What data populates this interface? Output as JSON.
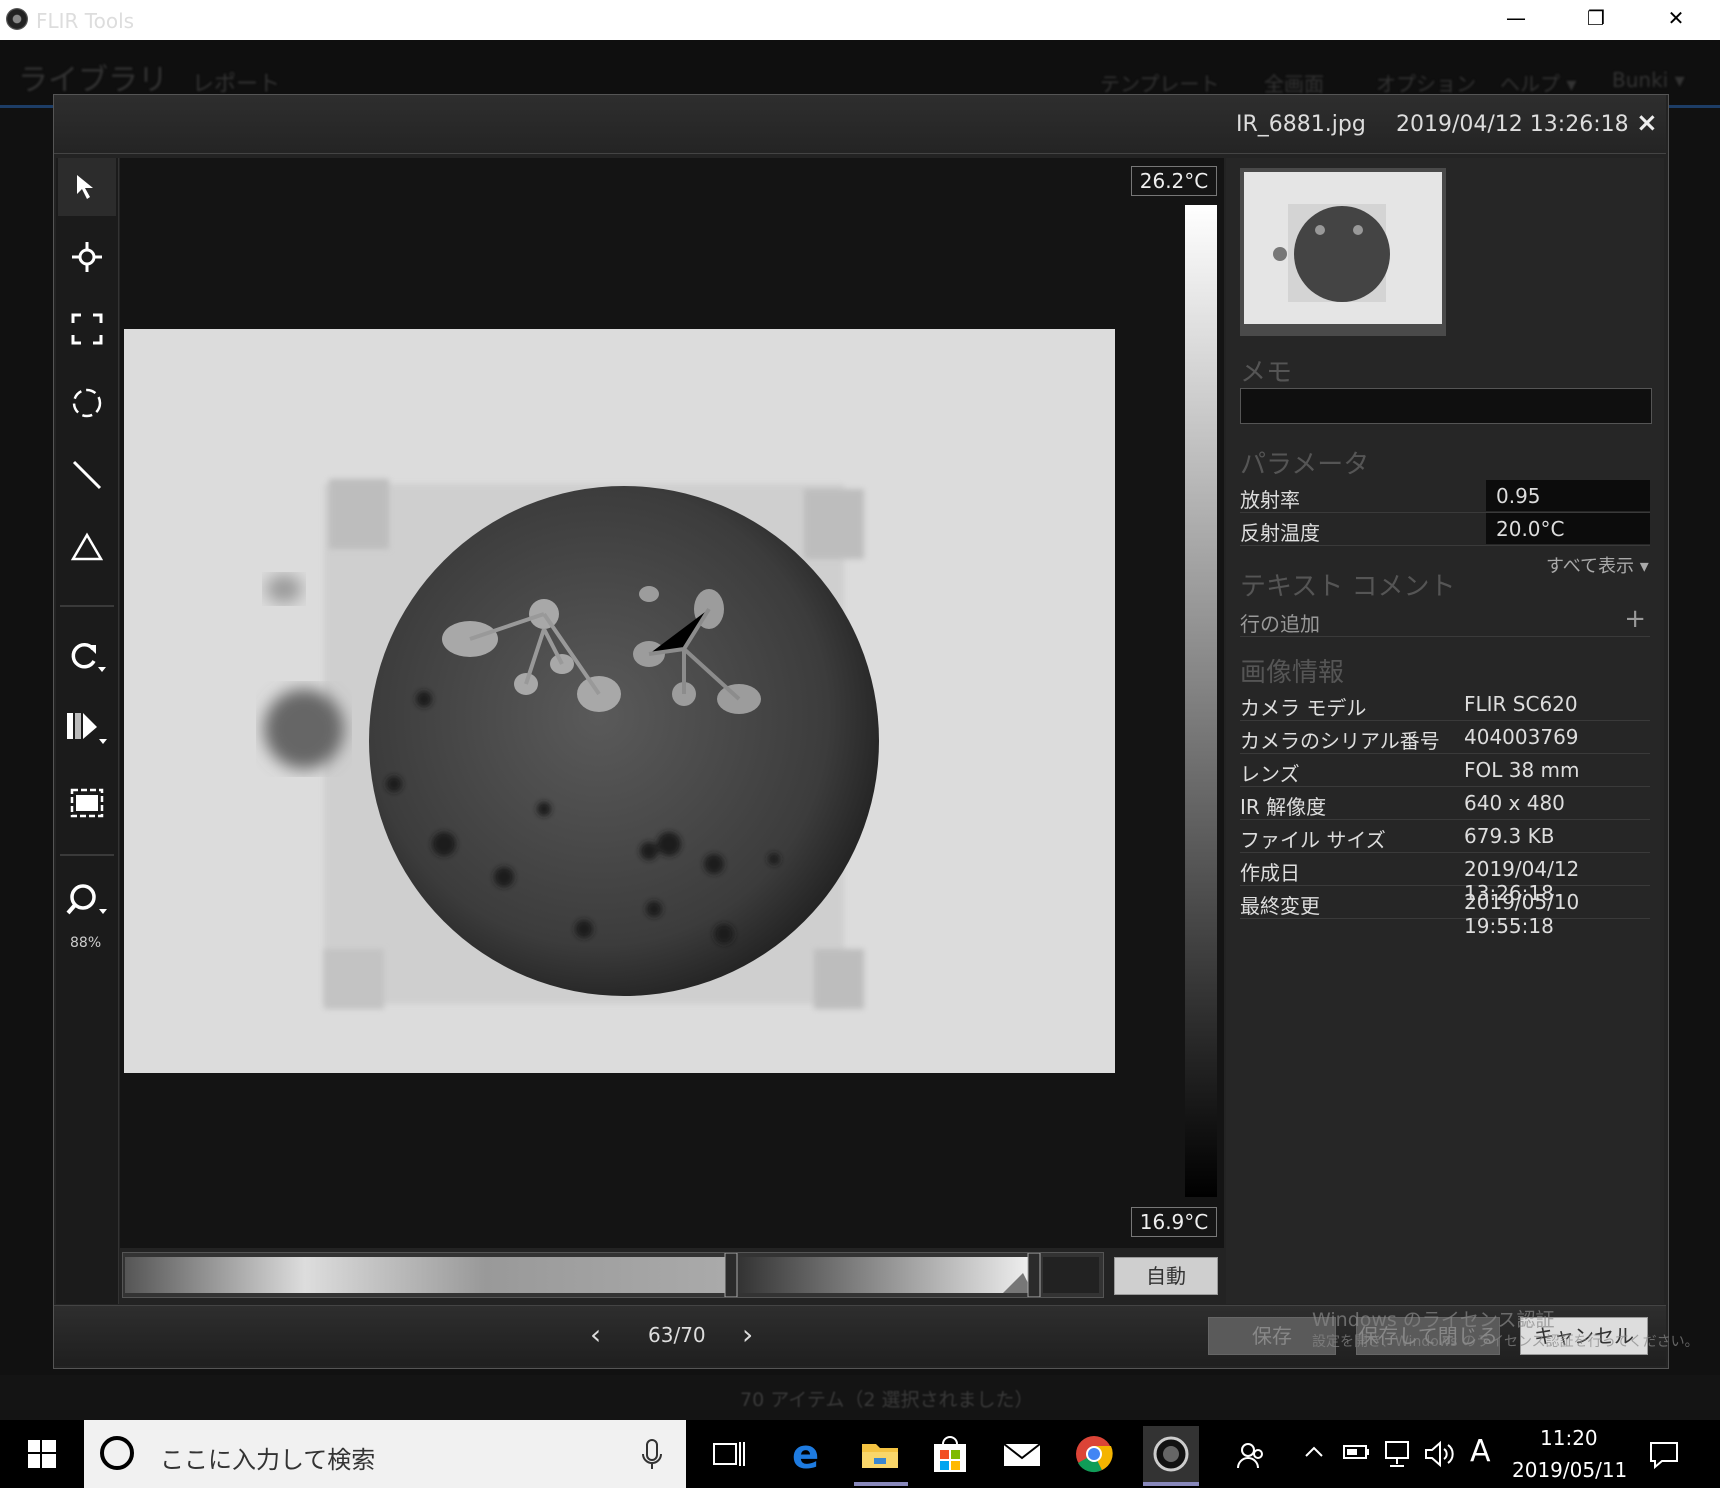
{
  "window": {
    "title": "FLIR Tools",
    "minimize": "—",
    "restore": "❐",
    "close": "✕"
  },
  "background_app": {
    "tabs": [
      "ライブラリ",
      "レポート"
    ],
    "menu": [
      "テンプレート",
      "全画面",
      "オプション",
      "ヘルプ ▾",
      "Bunki ▾"
    ],
    "status": "70 アイテム（2 選択されました）"
  },
  "dialog": {
    "filename": "IR_6881.jpg",
    "datetime": "2019/04/12 13:26:18",
    "close": "×"
  },
  "toolbar": {
    "zoom": "88%"
  },
  "scale": {
    "max": "26.2°C",
    "min": "16.9°C",
    "auto_button": "自動"
  },
  "panel": {
    "memo_title": "メモ",
    "params_title": "パラメータ",
    "params": [
      {
        "key": "放射率",
        "value": "0.95"
      },
      {
        "key": "反射温度",
        "value": "20.0°C"
      }
    ],
    "show_all": "すべて表示 ▾",
    "comment_title": "テキスト コメント",
    "add_line": "行の追加",
    "add_icon": "+",
    "info_title": "画像情報",
    "info": [
      {
        "key": "カメラ モデル",
        "value": "FLIR SC620"
      },
      {
        "key": "カメラのシリアル番号",
        "value": "404003769"
      },
      {
        "key": "レンズ",
        "value": "FOL 38 mm"
      },
      {
        "key": "IR 解像度",
        "value": "640 x 480"
      },
      {
        "key": "ファイル サイズ",
        "value": "679.3 KB"
      },
      {
        "key": "作成日",
        "value": "2019/04/12 13:26:18"
      },
      {
        "key": "最終変更",
        "value": "2019/05/10 19:55:18"
      }
    ]
  },
  "footer": {
    "prev": "‹",
    "next": "›",
    "page": "63/70",
    "save": "保存",
    "save_close": "保存して閉じる",
    "cancel": "キャンセル",
    "watermark_line1": "Windows のライセンス認証",
    "watermark_line2": "設定を開き、Windows のライセンス認証を行ってください。"
  },
  "taskbar": {
    "search_placeholder": "ここに入力して検索",
    "time": "11:20",
    "date": "2019/05/11",
    "ime": "A"
  }
}
